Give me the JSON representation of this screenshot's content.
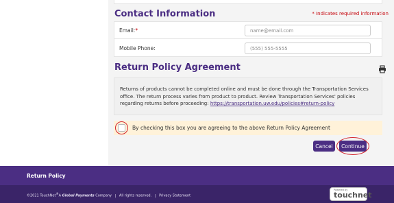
{
  "contact": {
    "title": "Contact Information",
    "required_note": "* Indicates required information",
    "email_label": "Email:",
    "email_required_marker": "*",
    "email_placeholder": "name@email.com",
    "phone_label": "Mobile Phone:",
    "phone_placeholder": "(555) 555-5555"
  },
  "return_policy": {
    "title": "Return Policy Agreement",
    "print_icon": "printer-icon",
    "text": "Returns of products cannot be completed online and must be done through the Transportation Services office. The return process varies from product to product. Review Transportation Services' policies regarding returns before proceeding:",
    "link": "https://transportation.uw.edu/policies#return-policy",
    "agree_label": "By checking this box you are agreeing to the above Return Policy Agreement",
    "agree_checked": false
  },
  "actions": {
    "cancel_label": "Cancel",
    "continue_label": "Continue"
  },
  "footer": {
    "nav_link": "Return Policy",
    "copyright_year": "©2021 TouchNet",
    "copyright_reg": "®",
    "copyright_mid": "A",
    "copyright_brand": "Global Payments",
    "copyright_suffix": "Company",
    "rights": "All rights reserved.",
    "privacy": "Privacy Statement",
    "sep": "|",
    "badge_powered": "Powered by",
    "badge_name": "touchnet"
  },
  "colors": {
    "brand_purple": "#4b2e83",
    "required_red": "#c5050c",
    "highlight_circle": "#d3262e",
    "agreement_bg": "#fff2d9"
  }
}
